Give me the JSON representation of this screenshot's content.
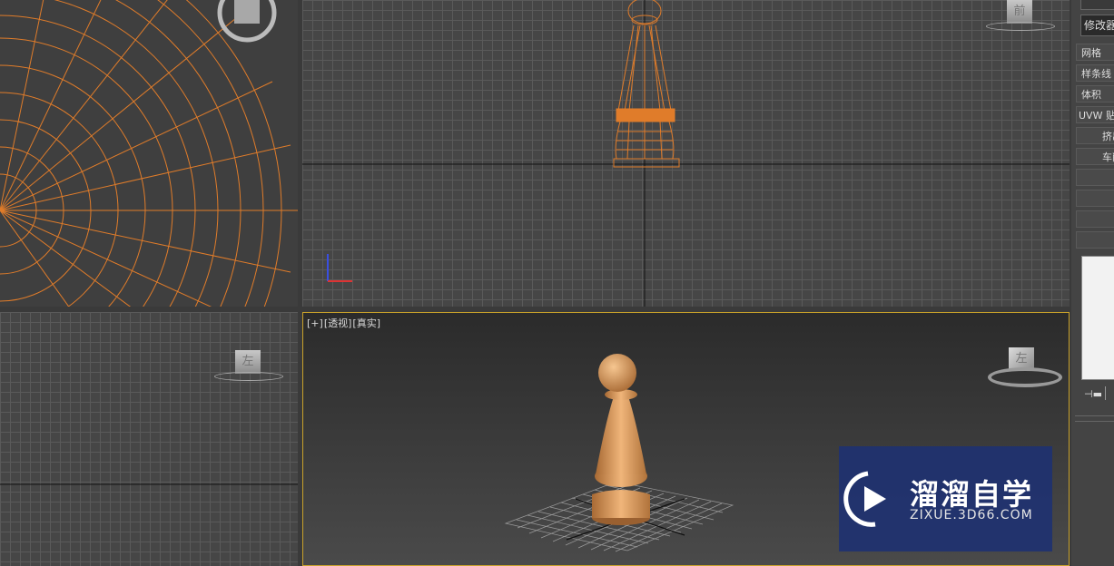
{
  "viewports": {
    "perspective": {
      "label_plus": "[+]",
      "label_view": "[透视]",
      "label_shading": "[真实]"
    },
    "viewcube_top_left": "",
    "viewcube_top_right": "前",
    "viewcube_left": "左",
    "viewcube_perspective": "左"
  },
  "command_panel": {
    "modifier_dropdown": "修改器",
    "buttons": [
      "网格",
      "样条线",
      "体积",
      "UVW 贴",
      "挤出",
      "车削"
    ],
    "pin_icon": "pin-icon"
  },
  "watermark": {
    "title": "溜溜自学",
    "url": "ZIXUE.3D66.COM"
  },
  "colors": {
    "wireframe": "#e07c2a",
    "model_fill": "#d89a5e",
    "viewport_border_active": "#c9a22a",
    "watermark_bg": "#1c3074"
  }
}
